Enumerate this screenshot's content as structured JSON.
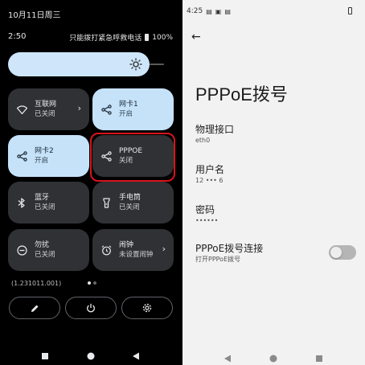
{
  "quick_settings": {
    "date": "10月11日周三",
    "time": "2:50",
    "status_text": "只能拨打紧急呼救电话",
    "battery": "100%",
    "tiles": [
      {
        "name": "internet",
        "label": "互联网",
        "state": "已关闭",
        "active": false,
        "icon": "wifi-icon",
        "has_chevron": true
      },
      {
        "name": "ethernet1",
        "label": "网卡1",
        "state": "开启",
        "active": true,
        "icon": "share-icon"
      },
      {
        "name": "ethernet2",
        "label": "网卡2",
        "state": "开启",
        "active": true,
        "icon": "share-icon"
      },
      {
        "name": "pppoe",
        "label": "PPPOE",
        "state": "关闭",
        "active": false,
        "icon": "share-icon",
        "highlighted": true
      },
      {
        "name": "bluetooth",
        "label": "蓝牙",
        "state": "已关闭",
        "active": false,
        "icon": "bluetooth-icon"
      },
      {
        "name": "flashlight",
        "label": "手电筒",
        "state": "已关闭",
        "active": false,
        "icon": "flashlight-icon"
      },
      {
        "name": "dnd",
        "label": "勿扰",
        "state": "已关闭",
        "active": false,
        "icon": "dnd-icon"
      },
      {
        "name": "alarm",
        "label": "闹钟",
        "state": "未设置闹钟",
        "active": false,
        "icon": "alarm-icon",
        "has_chevron": true
      }
    ],
    "build_text": "(1.231011.001)",
    "buttons": [
      "edit-icon",
      "power-icon",
      "settings-icon"
    ],
    "colors": {
      "tile_on": "#c5e2f9",
      "tile_off": "#303134",
      "highlight": "#d8141c"
    }
  },
  "pppoe_settings": {
    "status_time": "4:25",
    "title": "PPPoE拨号",
    "prefs": [
      {
        "title": "物理接口",
        "summary": "eth0"
      },
      {
        "title": "用户名",
        "summary": "12 ••• 6"
      },
      {
        "title": "密码",
        "summary": "••••••"
      },
      {
        "title": "PPPoE拨号连接",
        "summary": "打开PPPoE拨号",
        "toggle": false
      }
    ]
  }
}
